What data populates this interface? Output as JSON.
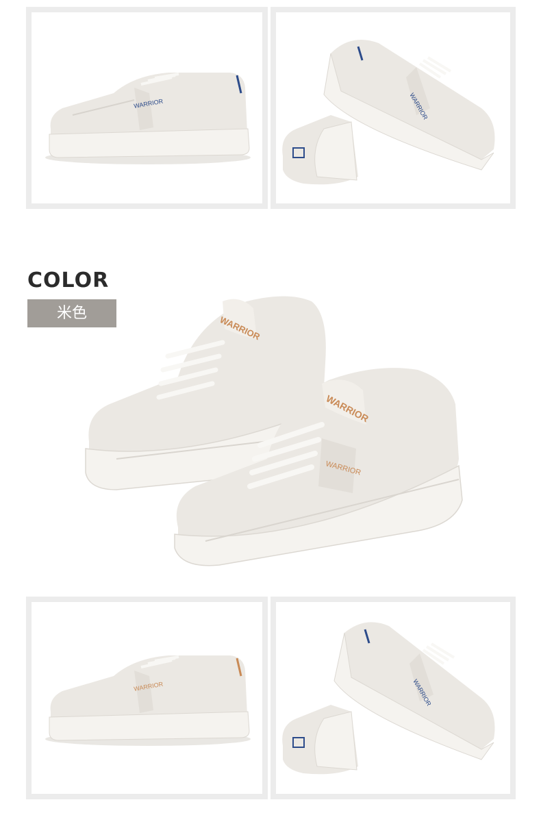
{
  "color_section": {
    "title": "COLOR",
    "swatch_label": "米色",
    "swatch_color": "#a19d98"
  },
  "branding": {
    "logo_text": "WARRIOR",
    "accent_blue": "#2c4b8a",
    "accent_orange": "#c98a56"
  },
  "shoe_colors": {
    "upper": "#efece7",
    "sole": "#f4f2ee",
    "lace": "#f8f7f4"
  }
}
